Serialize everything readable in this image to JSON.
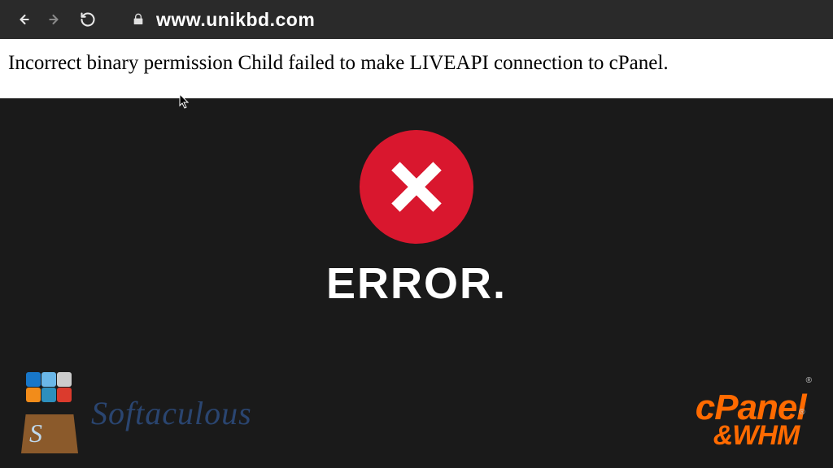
{
  "browser": {
    "url": "www.unikbd.com"
  },
  "error_panel": {
    "message": "Incorrect binary permission Child failed to make LIVEAPI connection to cPanel."
  },
  "center": {
    "label": "ERROR."
  },
  "logos": {
    "softaculous": "Softaculous",
    "cpanel_line1": "cPanel",
    "cpanel_line2": "&WHM",
    "reg": "®"
  },
  "colors": {
    "accent_red": "#d9172e",
    "accent_orange": "#ff6a00",
    "softaculous_blue": "#2a4570"
  }
}
